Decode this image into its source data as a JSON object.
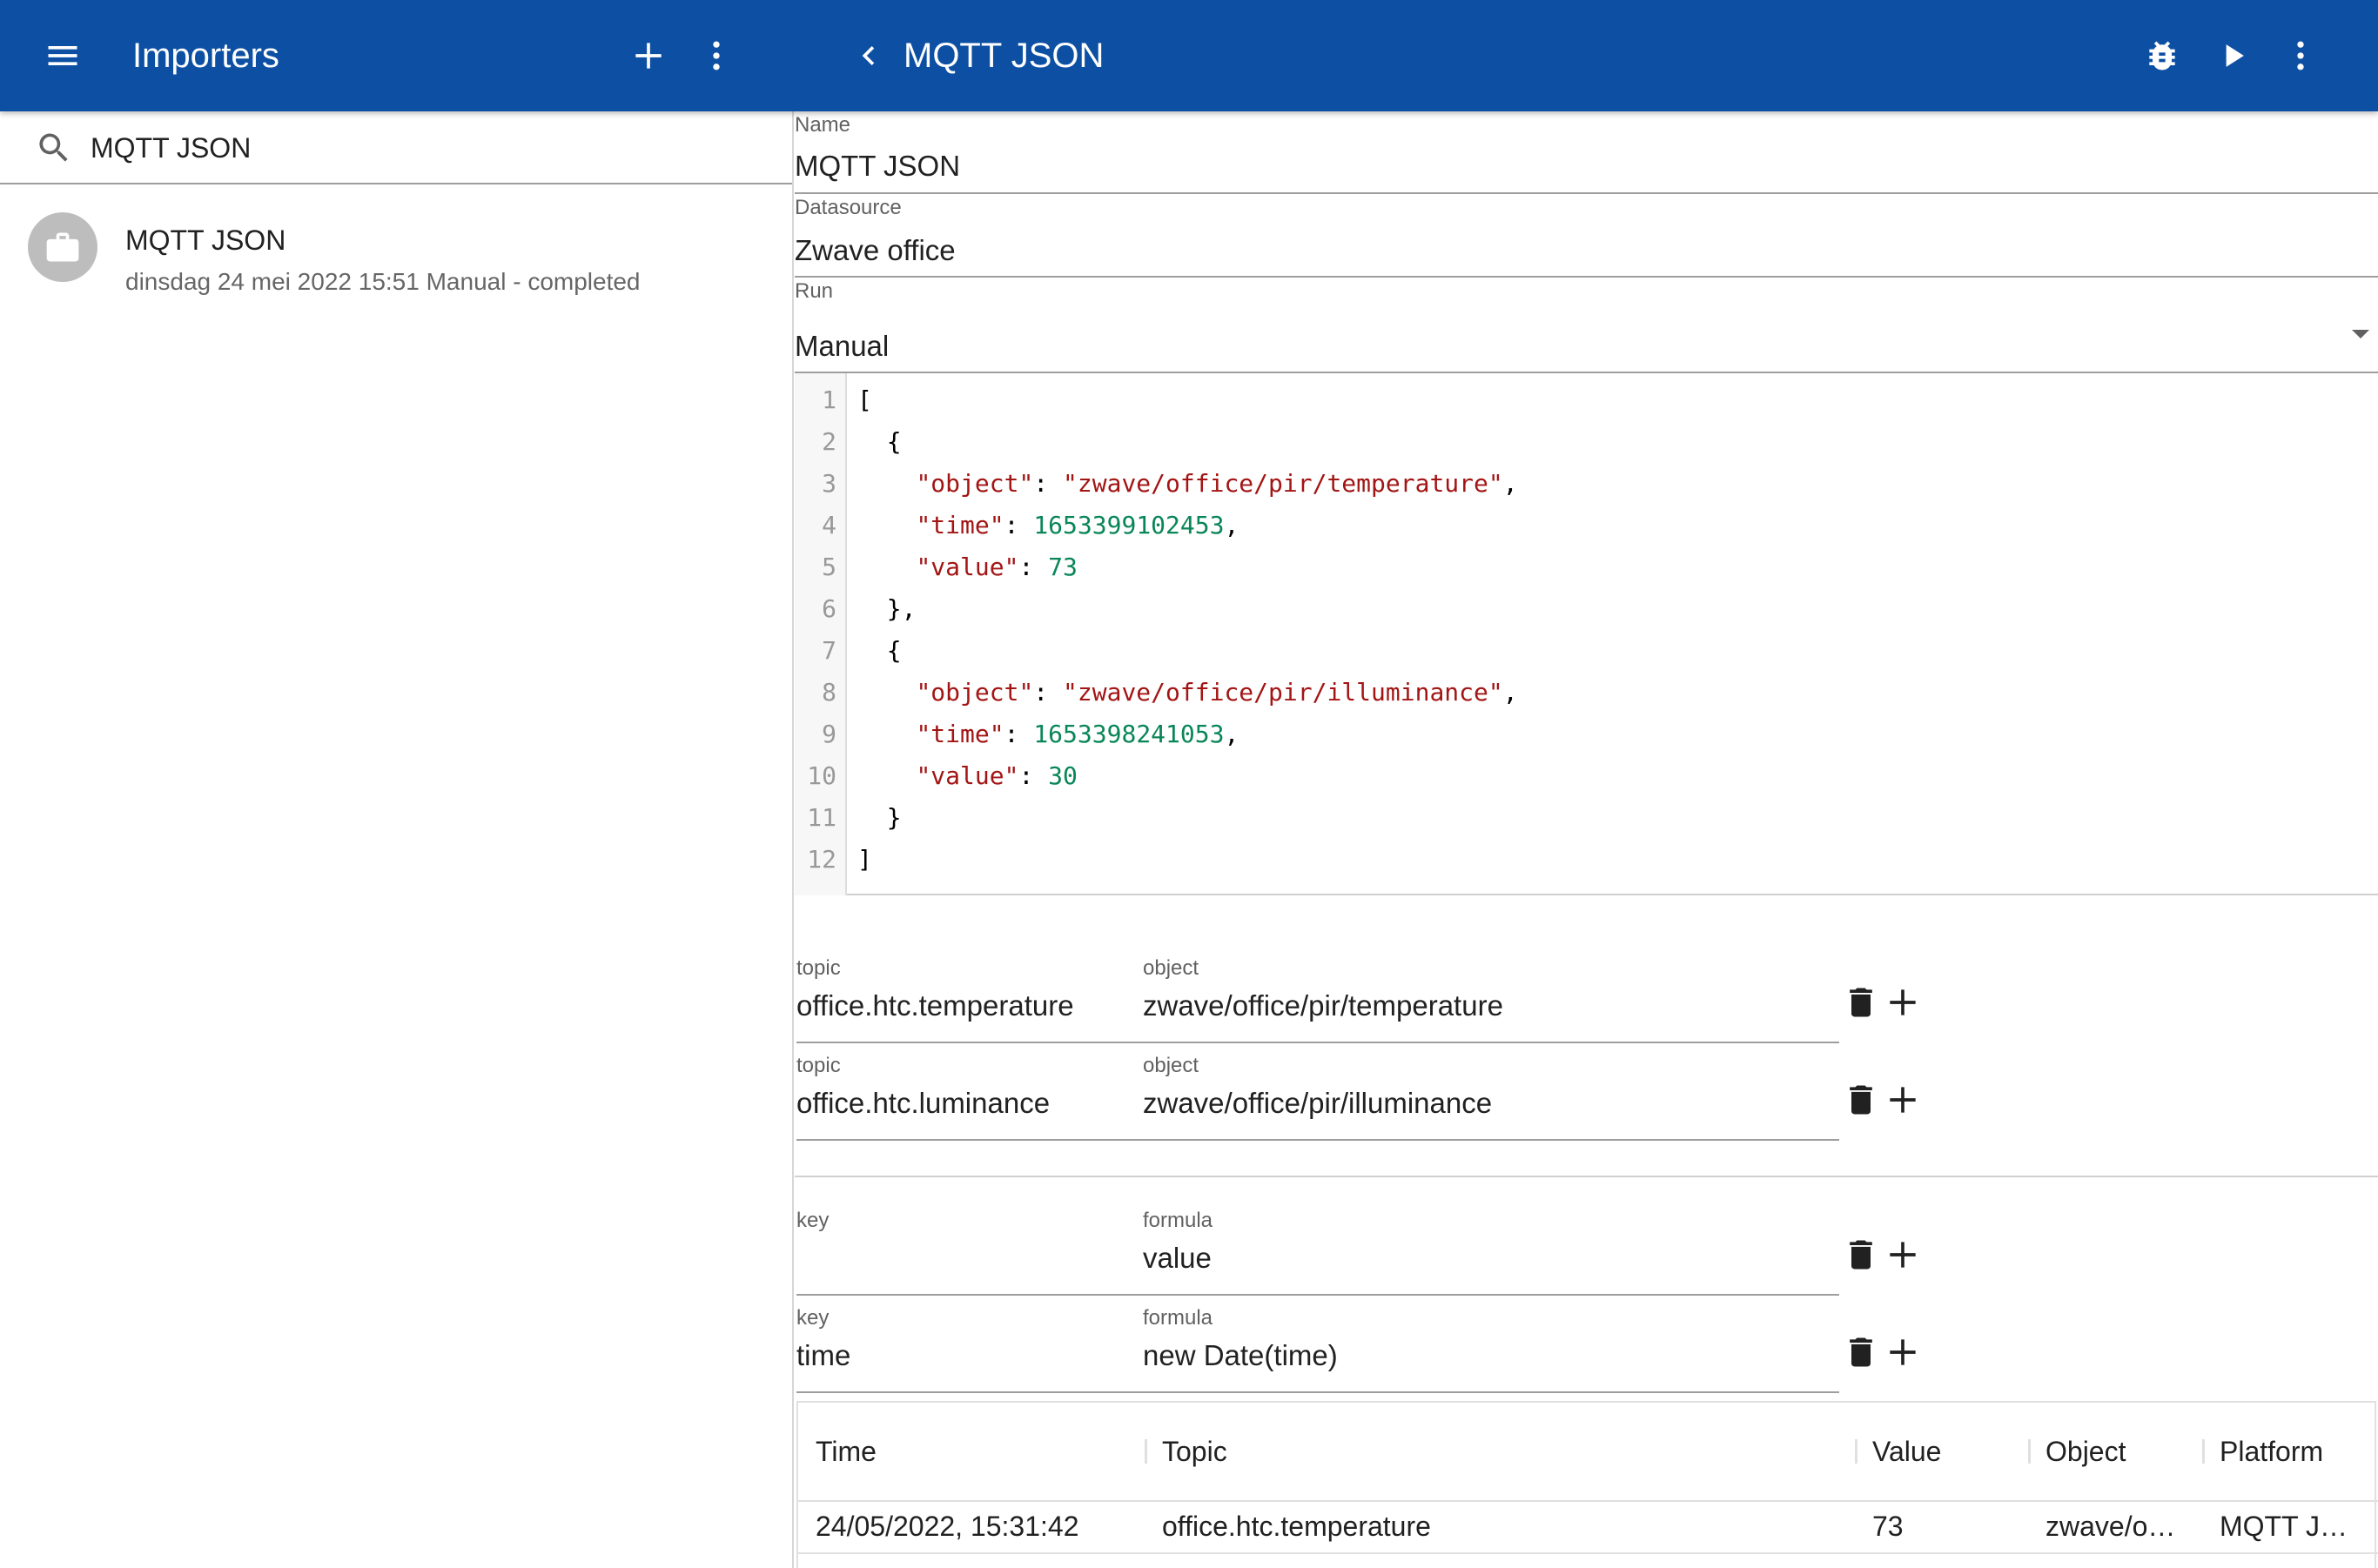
{
  "appbar": {
    "left_title": "Importers",
    "right_title": "MQTT JSON",
    "icons": [
      "menu-icon",
      "add-icon",
      "more-vert-icon",
      "chevron-left-icon",
      "bug-icon",
      "play-icon",
      "more-vert-icon"
    ],
    "color": "#0d50a3"
  },
  "search": {
    "value": "MQTT JSON"
  },
  "list": {
    "items": [
      {
        "title": "MQTT JSON",
        "subtitle": "dinsdag 24 mei 2022 15:51 Manual - completed",
        "icon": "briefcase-icon"
      }
    ]
  },
  "form": {
    "name_label": "Name",
    "name_value": "MQTT JSON",
    "datasource_label": "Datasource",
    "datasource_value": "Zwave office",
    "run_label": "Run",
    "run_value": "Manual"
  },
  "editor": {
    "line_numbers": [
      "1",
      "2",
      "3",
      "4",
      "5",
      "6",
      "7",
      "8",
      "9",
      "10",
      "11",
      "12"
    ],
    "lines": [
      "[",
      "  {",
      "    \"object\": \"zwave/office/pir/temperature\",",
      "    \"time\": 1653399102453,",
      "    \"value\": 73",
      "  },",
      "  {",
      "    \"object\": \"zwave/office/pir/illuminance\",",
      "    \"time\": 1653398241053,",
      "    \"value\": 30",
      "  }",
      "]"
    ]
  },
  "mappings": [
    {
      "label1": "topic",
      "value1": "office.htc.temperature",
      "label2": "object",
      "value2": "zwave/office/pir/temperature"
    },
    {
      "label1": "topic",
      "value1": "office.htc.luminance",
      "label2": "object",
      "value2": "zwave/office/pir/illuminance"
    }
  ],
  "formulas": [
    {
      "label1": "key",
      "value1": "",
      "label2": "formula",
      "value2": "value"
    },
    {
      "label1": "key",
      "value1": "time",
      "label2": "formula",
      "value2": "new Date(time)"
    }
  ],
  "table": {
    "headers": [
      "Time",
      "Topic",
      "Value",
      "Object",
      "Platform"
    ],
    "rows": [
      [
        "24/05/2022, 15:31:42",
        "office.htc.temperature",
        "73",
        "zwave/o…",
        "MQTT J…"
      ]
    ]
  }
}
